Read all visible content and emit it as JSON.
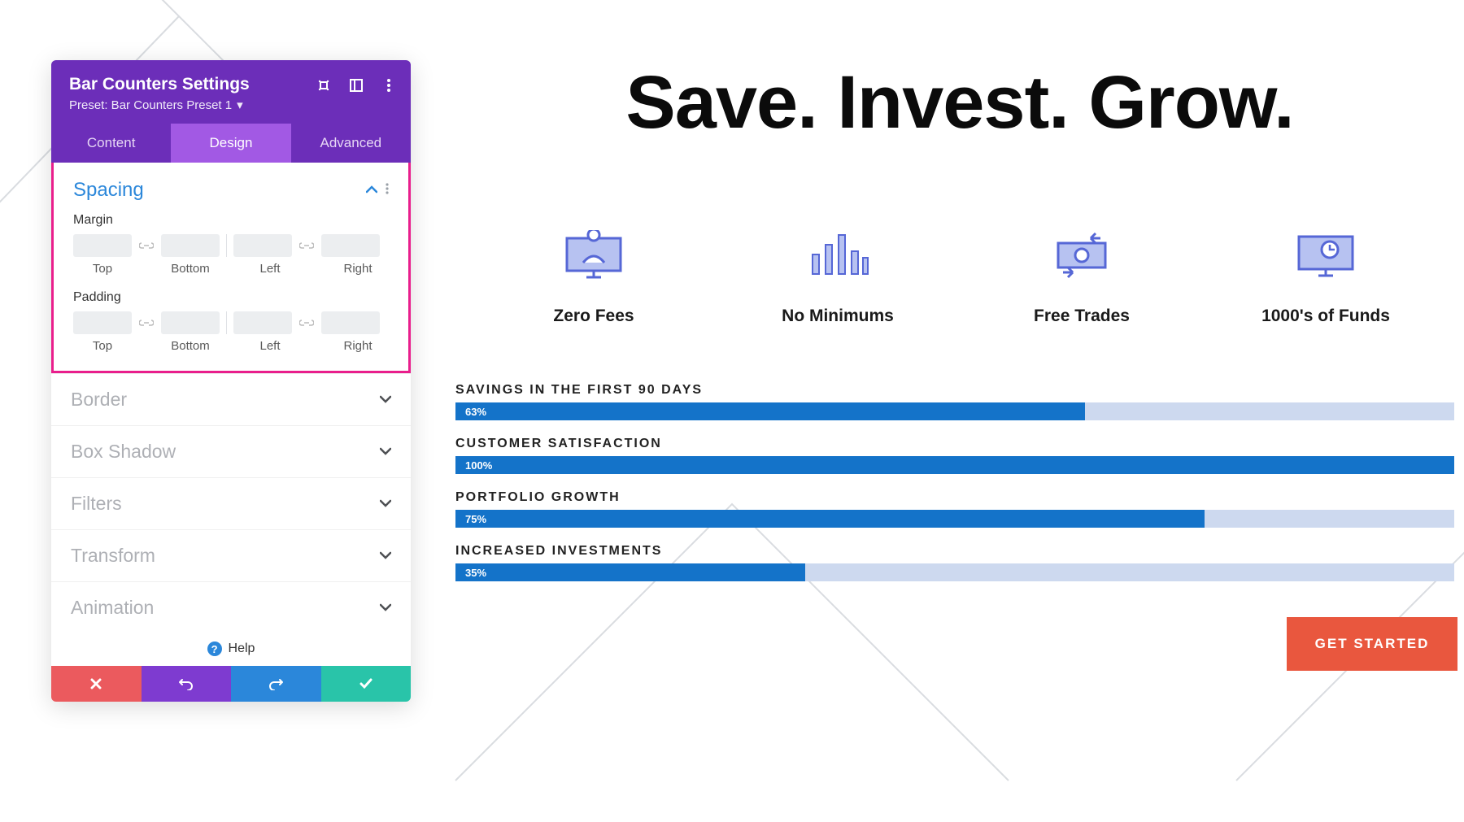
{
  "panel": {
    "title": "Bar Counters Settings",
    "preset": "Preset: Bar Counters Preset 1",
    "tabs": {
      "content": "Content",
      "design": "Design",
      "advanced": "Advanced",
      "active": "design"
    },
    "spacing": {
      "title": "Spacing",
      "margin_label": "Margin",
      "padding_label": "Padding",
      "sides": {
        "top": "Top",
        "bottom": "Bottom",
        "left": "Left",
        "right": "Right"
      }
    },
    "closed_sections": [
      "Border",
      "Box Shadow",
      "Filters",
      "Transform",
      "Animation"
    ],
    "help": "Help"
  },
  "hero": {
    "title": "Save. Invest. Grow."
  },
  "features": [
    {
      "label": "Zero Fees",
      "icon": "monitor-user"
    },
    {
      "label": "No Minimums",
      "icon": "bar-chart"
    },
    {
      "label": "Free Trades",
      "icon": "cash-transfer"
    },
    {
      "label": "1000's of Funds",
      "icon": "monitor-clock"
    }
  ],
  "chart_data": {
    "type": "bar",
    "orientation": "horizontal",
    "categories": [
      "SAVINGS IN THE FIRST 90 DAYS",
      "CUSTOMER SATISFACTION",
      "PORTFOLIO GROWTH",
      "INCREASED INVESTMENTS"
    ],
    "values": [
      63,
      100,
      75,
      35
    ],
    "value_suffix": "%",
    "ylim": [
      0,
      100
    ],
    "fill_color": "#1473c9",
    "track_color": "#cdd9ef"
  },
  "cta": {
    "label": "GET STARTED"
  }
}
